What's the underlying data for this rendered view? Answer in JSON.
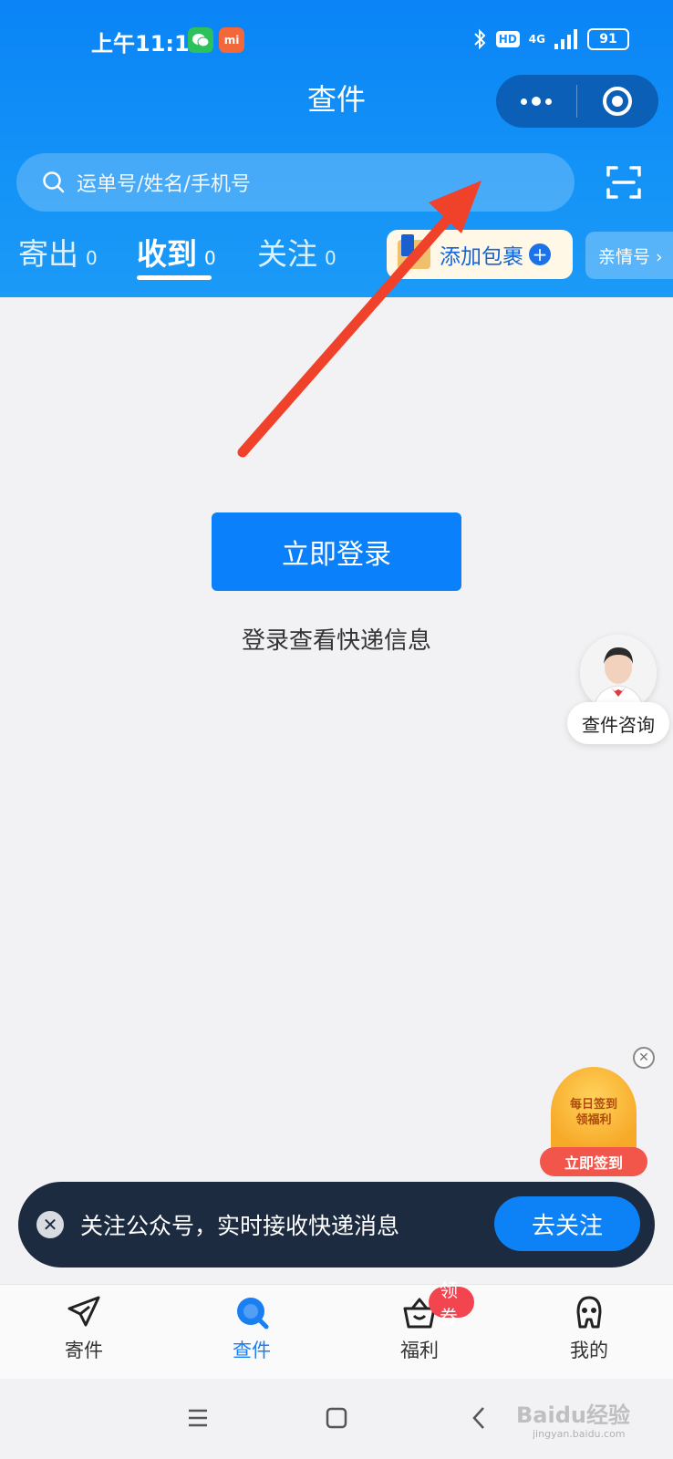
{
  "status_bar": {
    "time": "上午11:11",
    "wechat_icon": "wechat-icon",
    "mi_label": "mi",
    "hd_label": "HD",
    "network": "4G",
    "battery": "91"
  },
  "header": {
    "title": "查件",
    "more_icon": "more-dots-icon",
    "close_icon": "target-circle-icon"
  },
  "search": {
    "placeholder": "运单号/姓名/手机号",
    "scan_icon": "scan-icon"
  },
  "tabs": [
    {
      "label": "寄出",
      "count": "0"
    },
    {
      "label": "收到",
      "count": "0",
      "active": true
    },
    {
      "label": "关注",
      "count": "0"
    }
  ],
  "add_package": {
    "label": "添加包裹"
  },
  "family_link": {
    "label": "亲情号 ›"
  },
  "main": {
    "login_button": "立即登录",
    "login_hint": "登录查看快递信息"
  },
  "support": {
    "label": "查件咨询"
  },
  "signin_widget": {
    "line1": "每日签到",
    "line2": "领福利",
    "button": "立即签到"
  },
  "follow_banner": {
    "text": "关注公众号，实时接收快递消息",
    "button": "去关注"
  },
  "bottom_tabs": [
    {
      "label": "寄件",
      "icon": "paper-plane-icon"
    },
    {
      "label": "查件",
      "icon": "search-query-icon",
      "active": true
    },
    {
      "label": "福利",
      "icon": "gift-basket-icon",
      "badge": "领券"
    },
    {
      "label": "我的",
      "icon": "profile-icon"
    }
  ],
  "watermark": {
    "text": "Baidu经验",
    "sub": "jingyan.baidu.com"
  },
  "colors": {
    "brand_blue": "#0a84f6",
    "button_blue": "#0a80fb",
    "badge_red": "#f2454f",
    "annotation_red": "#f0412b"
  }
}
